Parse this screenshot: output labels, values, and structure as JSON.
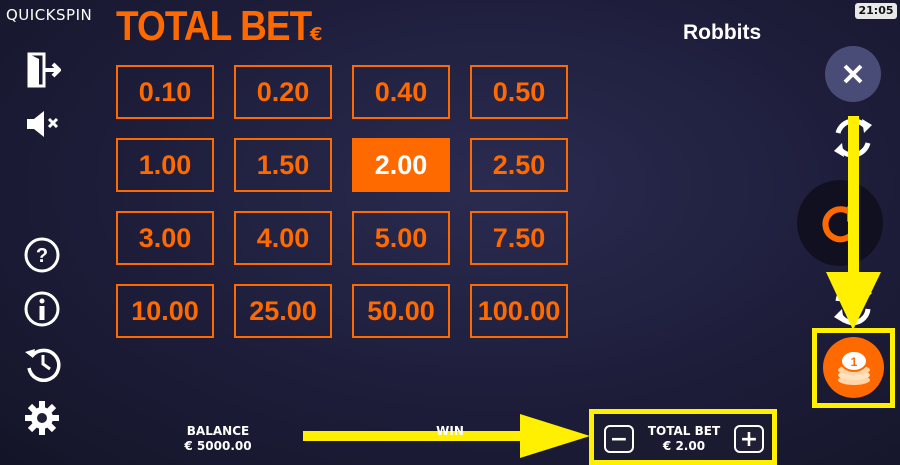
{
  "brand": "QUICKSPIN",
  "header": {
    "title": "TOTAL BET",
    "currency": "€",
    "game_name": "Robbits",
    "clock": "21:05"
  },
  "bets": [
    "0.10",
    "0.20",
    "0.40",
    "0.50",
    "1.00",
    "1.50",
    "2.00",
    "2.50",
    "3.00",
    "4.00",
    "5.00",
    "7.50",
    "10.00",
    "25.00",
    "50.00",
    "100.00"
  ],
  "selected_bet": "2.00",
  "footer": {
    "balance_label": "BALANCE",
    "balance_value": "€ 5000.00",
    "win_label": "WIN",
    "total_bet_label": "TOTAL BET",
    "total_bet_value": "€ 2.00",
    "minus": "−",
    "plus": "+"
  },
  "icons": [
    "exit-icon",
    "mute-icon",
    "help-icon",
    "info-icon",
    "history-icon",
    "settings-icon",
    "close-icon",
    "turbo-icon",
    "spin-icon",
    "autoplay-icon",
    "coin-stack-icon",
    "arrow-down-icon",
    "arrow-right-icon"
  ],
  "colors": {
    "accent": "#ff6a00",
    "highlight": "#ffef00",
    "background": "#1d1d3a"
  }
}
